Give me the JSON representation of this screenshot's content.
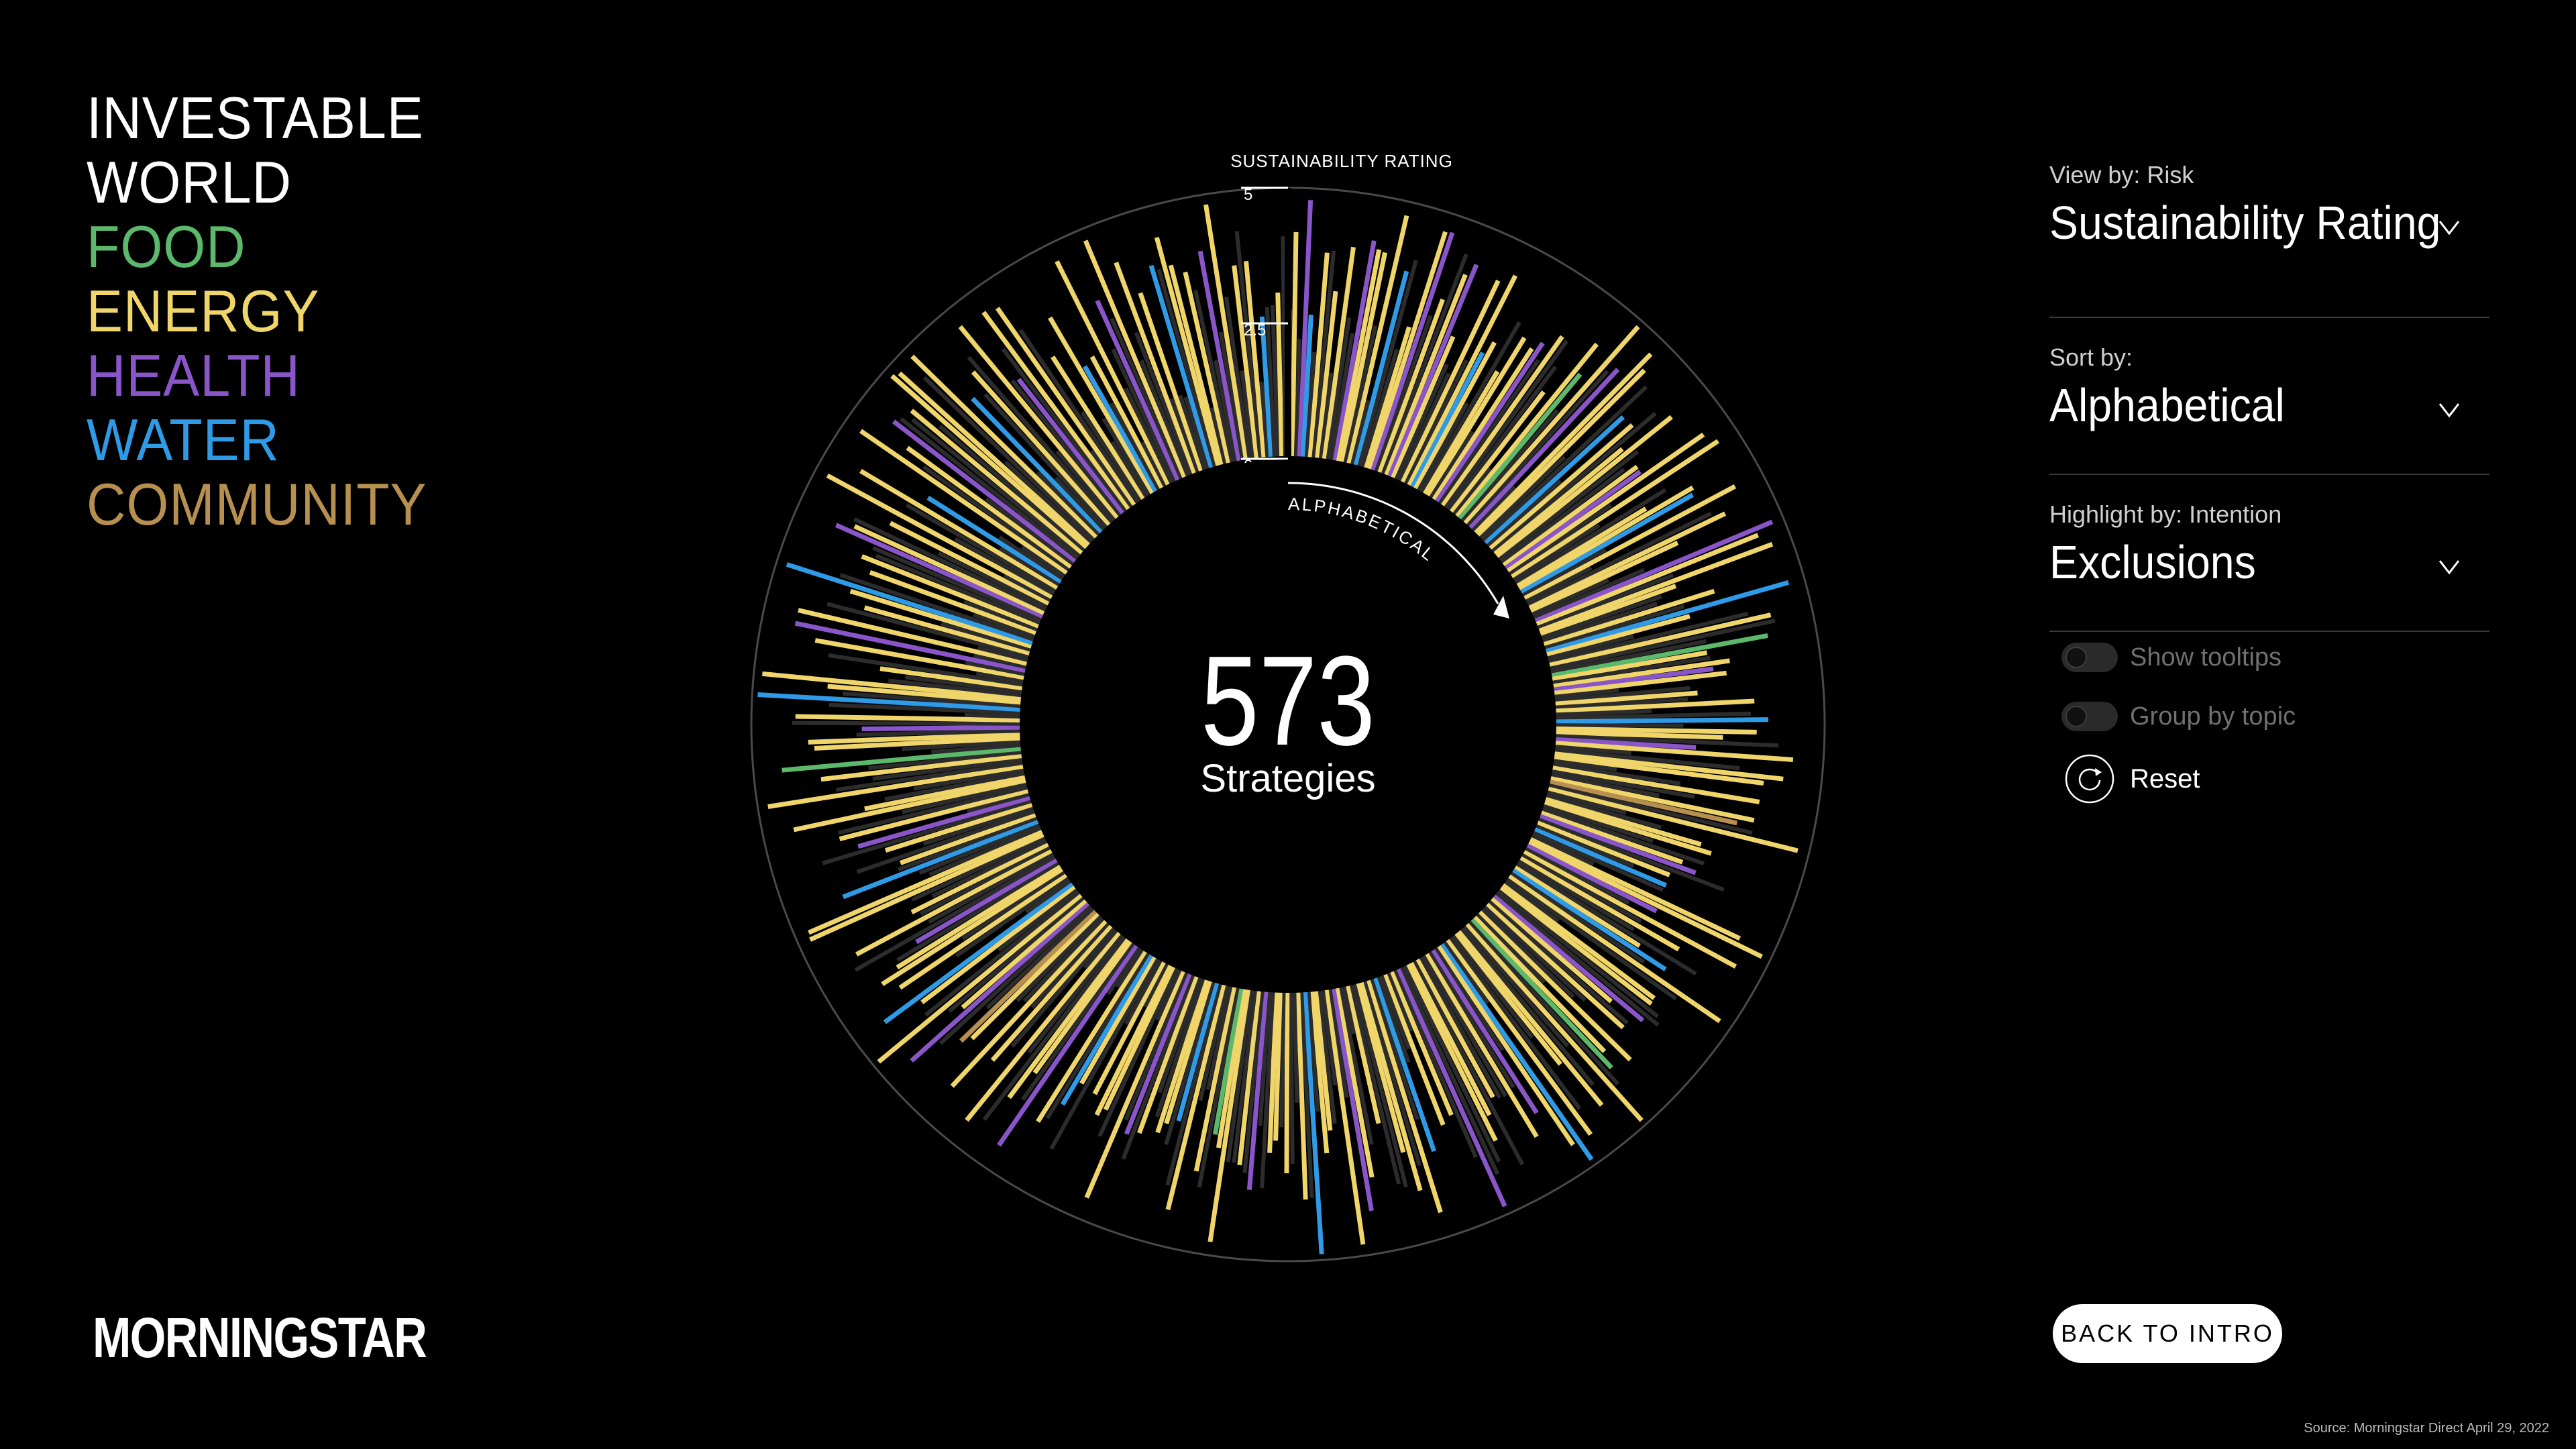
{
  "legend": {
    "title_line1": "INVESTABLE",
    "title_line2": "WORLD",
    "items": [
      {
        "label": "FOOD",
        "color": "#5cb86a"
      },
      {
        "label": "ENERGY",
        "color": "#efd56a"
      },
      {
        "label": "HEALTH",
        "color": "#8a55c9"
      },
      {
        "label": "WATER",
        "color": "#2f9be6"
      },
      {
        "label": "COMMUNITY",
        "color": "#b7904f"
      }
    ]
  },
  "controls": {
    "view_by_label": "View by: Risk",
    "view_by_value": "Sustainability Rating",
    "sort_by_label": "Sort by:",
    "sort_by_value": "Alphabetical",
    "highlight_label": "Highlight by: Intention",
    "highlight_value": "Exclusions",
    "show_tooltips": "Show tooltips",
    "group_by_topic": "Group by topic",
    "reset": "Reset"
  },
  "center": {
    "count": "573",
    "label": "Strategies"
  },
  "logo": "MORNINGSTAR",
  "back_button": "BACK TO INTRO",
  "source": "Source: Morningstar Direct April 29, 2022",
  "chart_data": {
    "type": "radial-bar",
    "title": "SUSTAINABILITY RATING",
    "sort_label": "ALPHABETICAL",
    "total_strategies": 573,
    "axis": {
      "ticks": [
        0,
        2.5,
        5
      ],
      "tick_labels": [
        "0",
        "2.5",
        "5"
      ],
      "range": [
        0,
        5
      ]
    },
    "colors": {
      "food": "#5cb86a",
      "energy": "#efd56a",
      "health": "#8a55c9",
      "water": "#2f9be6",
      "community": "#b7904f",
      "other": "#2c2c2c"
    },
    "note_series": "category codes: F=food, E=energy, H=health, W=water, C=community, .=not highlighted",
    "categories": "EE.HW.E.E.E..HEE.E.W..EEH.E.EHE..E.EWE..EE.EH.E..E.EF.E.H.EE..W.E.EE..EHE.E..EEW.E..EE..HE.EE..E.WE..E..FE.EHE..E.E..W.EE.HE..EE..E..EC.E..EE..EH.E.W..EEH.E.E..EW.E..EE..HE.E..E.EF.E..EE..E.WE.H.E..E.EE..H.E.E..W.E.EE..E..EH.E..EE.W.E..E.EE..H.E..EEF.E..E.W.EE..E.H.E..EE.E..EW.E..H.EE..E..E.E..EC..HE.E..EW..E.EE.H..E.E..EE..W.E..E.H.E..EE..E..E.F..EE.H.E..W.EE..E..E.H.E..E.EW..E.E..HE..E.E..E.W..E.E.H..E.EE..E.W..E..E.H.E.E..E..EW.E.E..H.E..E.E..W.EE.E..H.E..E.E.W..E.",
    "values_seed": 573
  }
}
